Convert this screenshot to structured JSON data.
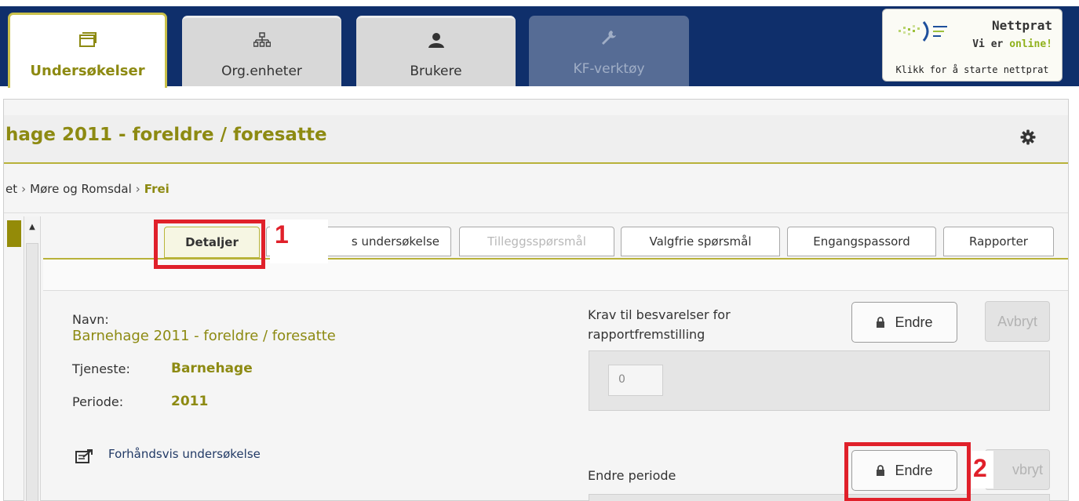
{
  "nav": {
    "tabs": [
      {
        "label": "Undersøkelser",
        "icon": "window-icon",
        "active": true
      },
      {
        "label": "Org.enheter",
        "icon": "org-chart-icon",
        "active": false
      },
      {
        "label": "Brukere",
        "icon": "user-icon",
        "active": false
      },
      {
        "label": "KF-verktøy",
        "icon": "wrench-icon",
        "active": false,
        "disabled": true
      }
    ]
  },
  "nettprat": {
    "title": "Nettprat",
    "status_prefix": "Vi er",
    "status_online": "online!",
    "start_text": "Klikk for å starte nettprat"
  },
  "page": {
    "title": "hage 2011 - foreldre / foresatte",
    "breadcrumb": [
      {
        "label": "et"
      },
      {
        "label": "Møre og Romsdal"
      },
      {
        "label": "Frei",
        "current": true
      }
    ]
  },
  "subtabs": [
    {
      "label": "Detaljer",
      "active": true
    },
    {
      "label": "s undersøkelse"
    },
    {
      "label": "Tilleggsspørsmål",
      "disabled": true
    },
    {
      "label": "Valgfrie spørsmål"
    },
    {
      "label": "Engangspassord"
    },
    {
      "label": "Rapporter"
    }
  ],
  "annotations": {
    "one": "1",
    "two": "2"
  },
  "details": {
    "navn_label": "Navn:",
    "navn_value": "Barnehage 2011 - foreldre / foresatte",
    "tjeneste_label": "Tjeneste:",
    "tjeneste_value": "Barnehage",
    "periode_label": "Periode:",
    "periode_value": "2011",
    "preview_link": "Forhåndsvis undersøkelse"
  },
  "krav": {
    "label": "Krav til besvarelser for rapportfremstilling",
    "value": "0",
    "edit_button": "Endre",
    "cancel_button": "Avbryt"
  },
  "endre_periode": {
    "label": "Endre periode",
    "edit_button": "Endre",
    "cancel_button": "vbryt"
  },
  "colors": {
    "nav_bg": "#0f2f6b",
    "olive": "#8d8a12",
    "accent_line": "#b8b23a",
    "annotation_red": "#e0202a",
    "online_green": "#8fb11b"
  }
}
